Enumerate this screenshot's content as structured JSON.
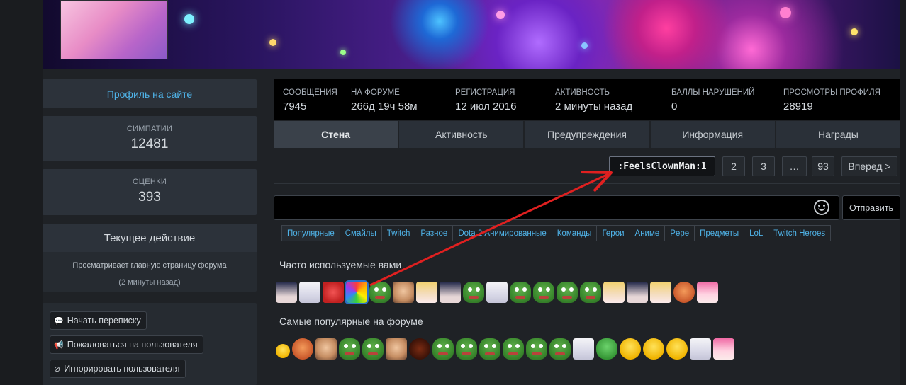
{
  "profile": {
    "link_label": "Профиль на сайте",
    "likes_label": "СИМПАТИИ",
    "likes_value": "12481",
    "ratings_label": "ОЦЕНКИ",
    "ratings_value": "393",
    "activity_title": "Текущее действие",
    "activity_text": "Просматривает главную страницу форума",
    "activity_time": "(2 минуты назад)"
  },
  "actions": {
    "start_conversation": "Начать переписку",
    "report_user": "Пожаловаться на пользователя",
    "ignore_user": "Игнорировать пользователя"
  },
  "stats": [
    {
      "label": "СООБЩЕНИЯ",
      "value": "7945"
    },
    {
      "label": "НА ФОРУМЕ",
      "value": "266д 19ч 58м"
    },
    {
      "label": "РЕГИСТРАЦИЯ",
      "value": "12 июл 2016"
    },
    {
      "label": "АКТИВНОСТЬ",
      "value": "2 минуты назад"
    },
    {
      "label": "БАЛЛЫ НАРУШЕНИЙ",
      "value": "0"
    },
    {
      "label": "ПРОСМОТРЫ ПРОФИЛЯ",
      "value": "28919"
    }
  ],
  "tabs": [
    "Стена",
    "Активность",
    "Предупреждения",
    "Информация",
    "Награды"
  ],
  "pagination": {
    "current": ":FeelsClownMan:1",
    "pages": [
      "2",
      "3",
      "…",
      "93"
    ],
    "next": "Вперед >"
  },
  "composer": {
    "send_label": "Отправить",
    "input_value": ""
  },
  "emoji_tabs": [
    "Популярные",
    "Смайлы",
    "Twitch",
    "Разное",
    "Dota 2 Анимированные",
    "Команды",
    "Герои",
    "Аниме",
    "Pepe",
    "Предметы",
    "LoL",
    "Twitch Heroes"
  ],
  "emoji_sections": {
    "frequent_title": "Часто используемые вами",
    "popular_title": "Самые популярные на форуме"
  },
  "colors": {
    "accent": "#4fb3e8",
    "annotation_arrow": "#e02020"
  }
}
